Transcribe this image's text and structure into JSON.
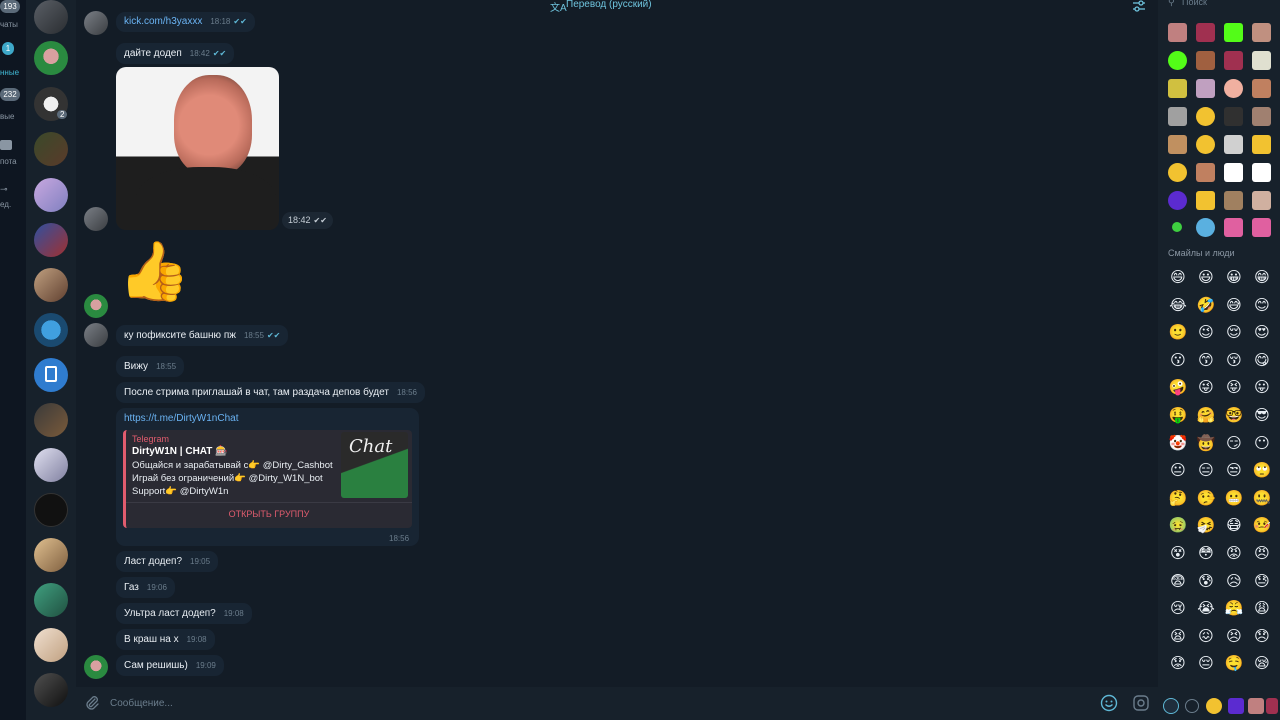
{
  "folders": [
    {
      "badge": "193",
      "label": "чаты",
      "active": false
    },
    {
      "badge": "1",
      "label": "нные",
      "active": true
    },
    {
      "badge": "232",
      "label": "вые",
      "active": false
    },
    {
      "badge": "",
      "label": "пота",
      "active": false
    },
    {
      "badge": "",
      "label": "ед.",
      "active": false
    }
  ],
  "chatlist": {
    "avatar_badge": "2"
  },
  "header": {
    "translate_title": "Перевод (русский)",
    "translate_icon": "translate-icon",
    "settings_icon": "sliders-icon"
  },
  "messages": [
    {
      "text": "kick.com/h3yaxxx",
      "time": "18:18",
      "is_link": true,
      "read": true
    },
    {
      "text": "дайте додеп",
      "time": "18:42",
      "read": true
    },
    {
      "text": "",
      "time": "18:42",
      "read": true,
      "kind": "photo"
    },
    {
      "text": "👍",
      "time": "",
      "kind": "sticker"
    },
    {
      "text": "ку пофиксите башню пж",
      "time": "18:55",
      "read": true
    },
    {
      "text": "Вижу",
      "time": "18:55"
    },
    {
      "text": "После стрима приглашай в чат, там раздача депов будет",
      "time": "18:56"
    },
    {
      "kind": "link_preview",
      "url": "https://t.me/DirtyW1nChat",
      "site": "Telegram",
      "title": "DirtyW1N | CHAT 🎰",
      "lines": [
        "Общайся и зарабатывай с👉 @Dirty_Cashbot",
        "Играй без ограничений👉 @Dirty_W1N_bot",
        "Support👉 @DirtyW1n"
      ],
      "thumb_text": "Chat",
      "button": "ОТКРЫТЬ ГРУППУ",
      "time": "18:56"
    },
    {
      "text": "Ласт додеп?",
      "time": "19:05"
    },
    {
      "text": "Газ",
      "time": "19:06"
    },
    {
      "text": "Ультра ласт додеп?",
      "time": "19:08"
    },
    {
      "text": "В краш на х",
      "time": "19:08"
    },
    {
      "text": "Сам решишь)",
      "time": "19:09"
    }
  ],
  "input": {
    "placeholder": "Сообщение...",
    "attach_icon": "paperclip-icon",
    "emoji_icon": "smile-icon",
    "bot_icon": "bot-commands-icon"
  },
  "emoji_panel": {
    "search_placeholder": "Поиск",
    "section_label": "Смайлы и люди",
    "emojis": [
      "😄",
      "😃",
      "😀",
      "😁",
      "😂",
      "🤣",
      "😅",
      "😊",
      "🙂",
      "😉",
      "😌",
      "😍",
      "😗",
      "😙",
      "😚",
      "😋",
      "🤪",
      "😜",
      "😝",
      "😛",
      "🤑",
      "🤗",
      "🤓",
      "😎",
      "🤡",
      "🤠",
      "😏",
      "😶",
      "😐",
      "😑",
      "😒",
      "🙄",
      "🤔",
      "🤥",
      "😬",
      "🤐",
      "🤢",
      "🤧",
      "😷",
      "🤒",
      "😵",
      "😳",
      "😡",
      "😠",
      "😨",
      "😰",
      "😥",
      "😓",
      "😢",
      "😭",
      "😤",
      "😩",
      "😫",
      "😖",
      "😣",
      "😞",
      "😟",
      "😔",
      "🤤",
      "😪",
      "😴",
      "😮",
      "😯",
      "😲"
    ],
    "clock_icon": "recent-clock-icon"
  },
  "colors": {
    "background": "#131c26",
    "bubble": "#182533",
    "accent": "#5fb8d6",
    "link_preview_bar": "#e05c6e",
    "link": "#6ab3f3"
  }
}
